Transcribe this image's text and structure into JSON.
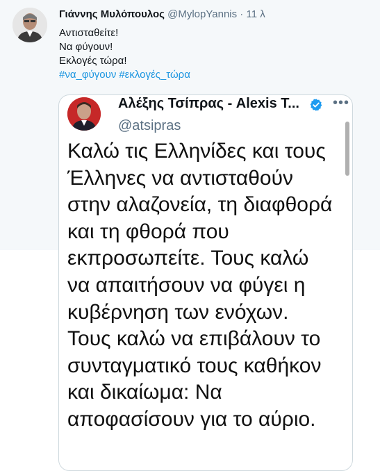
{
  "tweet": {
    "author_name": "Γιάννης Μυλόπουλος",
    "author_handle": "@MylopYannis",
    "separator": "·",
    "time": "11 λ",
    "lines": [
      "Αντισταθείτε!",
      "Να φύγουν!",
      "Εκλογές τώρα!"
    ],
    "hashtags": [
      "#να_φύγουν",
      "#εκλογές_τώρα"
    ]
  },
  "embedded": {
    "name": "Αλέξης Τσίπρας - Alexis T...",
    "handle": "@atsipras",
    "more": "•••",
    "lines": [
      "Καλώ τις Ελληνίδες και τους",
      "Έλληνες να αντισταθούν",
      "στην αλαζονεία, τη διαφθορά",
      "και τη φθορά που",
      "εκπροσωπείτε. Τους καλώ",
      "να απαιτήσουν να φύγει η",
      "κυβέρνηση των ενόχων.",
      "Τους καλώ να επιβάλουν το",
      "συνταγματικό τους καθήκον",
      "και δικαίωμα: Να",
      "αποφασίσουν για το αύριο."
    ]
  },
  "colors": {
    "link": "#1b95e0",
    "verified": "#1d9bf0"
  },
  "icons": {
    "verified": "verified-badge-icon"
  }
}
